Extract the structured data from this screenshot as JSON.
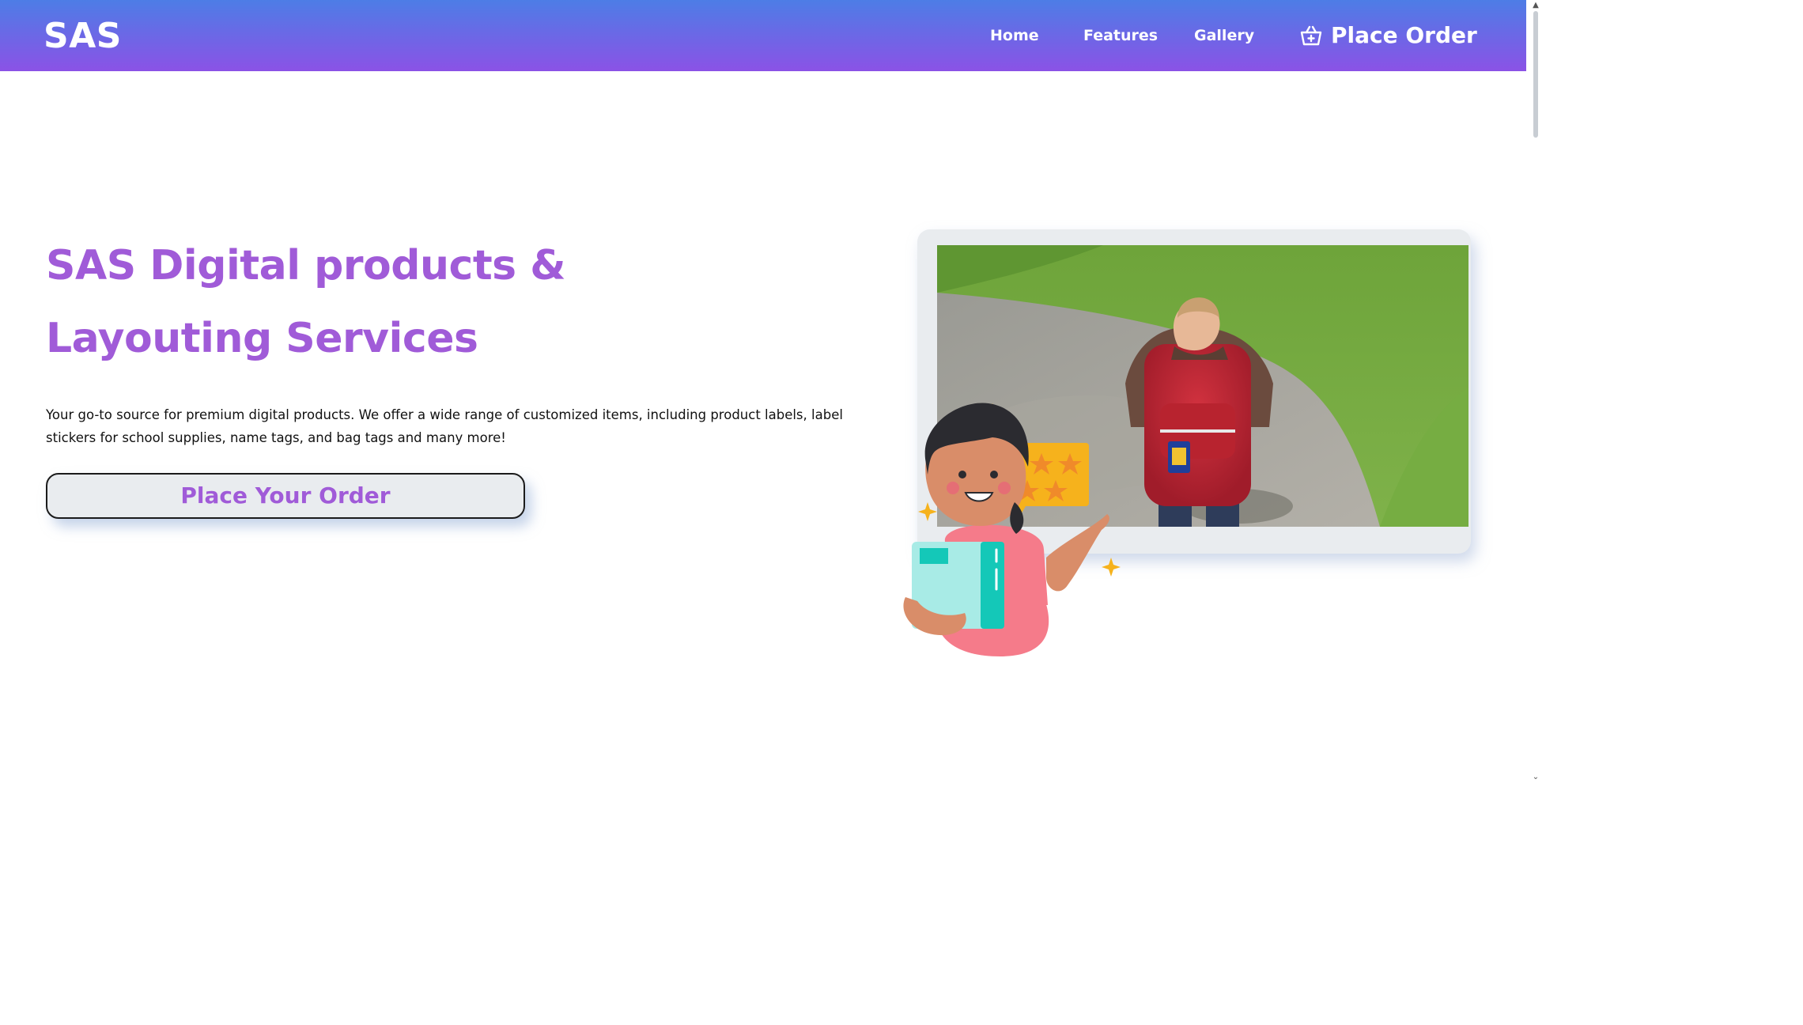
{
  "navbar": {
    "brand": "SAS",
    "links": [
      "Home",
      "Features",
      "Gallery"
    ],
    "order_label": "Place Order",
    "order_icon": "basket-icon"
  },
  "hero": {
    "title_lines": [
      "SAS Digital products &",
      "Layouting Services"
    ],
    "description": "Your go-to source for premium digital products. We offer a wide range of customized items, including product labels, label stickers for school supplies, name tags, and bag tags and many more!",
    "cta_label": "Place Your Order",
    "photo": "photo of a boy with a red backpack on a path",
    "illustration": "cartoon girl holding books with rating stars"
  },
  "colors": {
    "nav_gradient_top": "#4d7de6",
    "nav_gradient_bottom": "#8b52e6",
    "accent_purple": "#a05bd8",
    "frame_gray": "#e9ecef"
  },
  "scrollbar": {
    "up_icon": "scroll-up-arrow-icon",
    "down_icon": "scroll-down-arrow-icon"
  }
}
